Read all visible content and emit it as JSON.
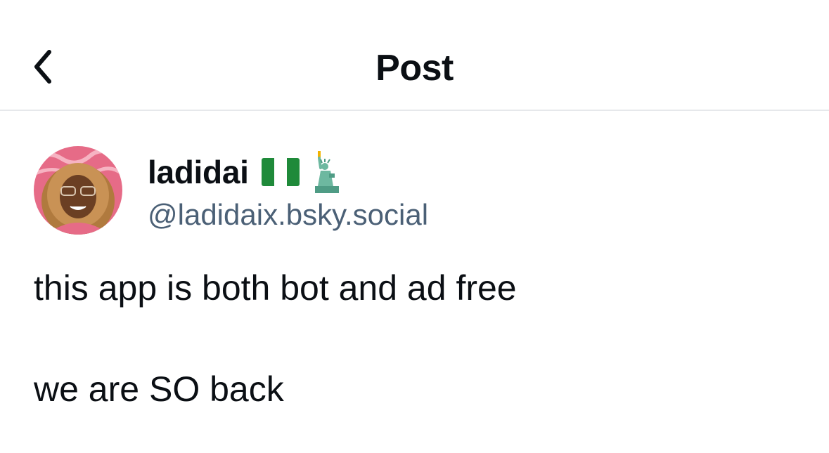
{
  "header": {
    "title": "Post",
    "back_icon": "chevron-left-icon"
  },
  "post": {
    "author": {
      "display_name": "ladidai",
      "emoji_icons": [
        "nigeria-flag-icon",
        "statue-of-liberty-icon"
      ],
      "handle": "@ladidaix.bsky.social"
    },
    "text_lines": [
      "this app is both bot and ad free",
      "we are SO back"
    ]
  },
  "colors": {
    "text": "#0b0f14",
    "handle": "#4b6076",
    "divider": "#e6e8eb",
    "flag_green": "#1f8a3a",
    "avatar_bg": "#e66b87"
  }
}
